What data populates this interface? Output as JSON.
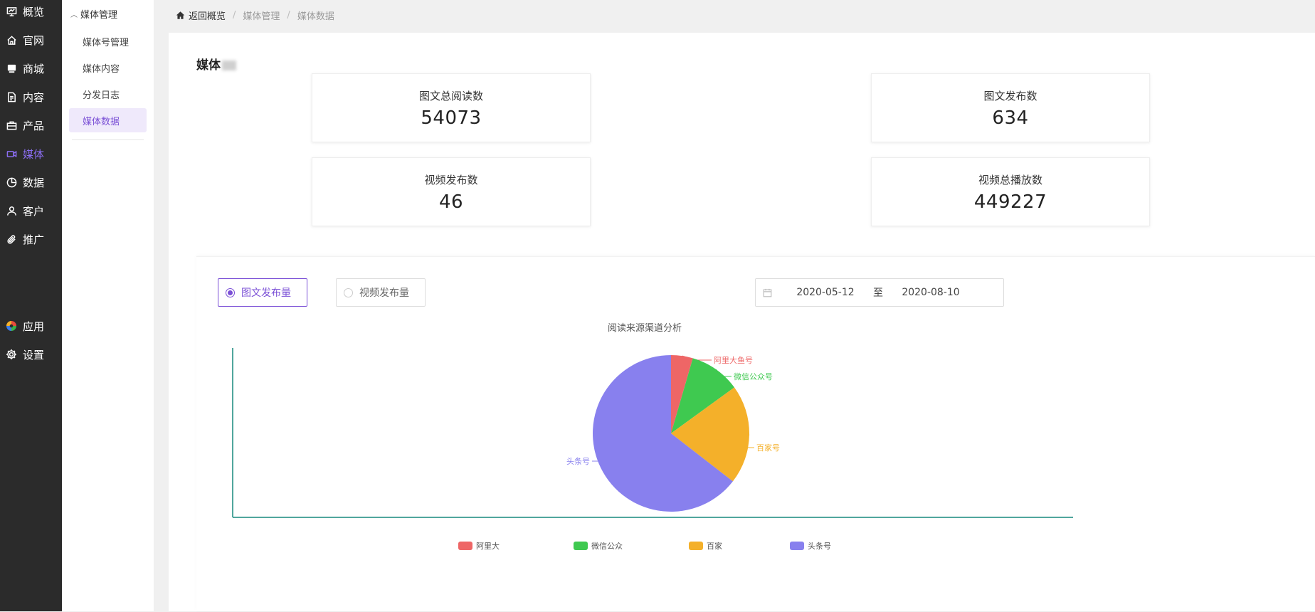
{
  "nav": {
    "items": [
      {
        "label": "概览",
        "icon": "dashboard-icon"
      },
      {
        "label": "官网",
        "icon": "home-icon"
      },
      {
        "label": "商城",
        "icon": "store-icon"
      },
      {
        "label": "内容",
        "icon": "document-icon"
      },
      {
        "label": "产品",
        "icon": "briefcase-icon"
      },
      {
        "label": "媒体",
        "icon": "video-icon"
      },
      {
        "label": "数据",
        "icon": "pie-icon"
      },
      {
        "label": "客户",
        "icon": "user-icon"
      },
      {
        "label": "推广",
        "icon": "paperclip-icon"
      }
    ],
    "bottom": [
      {
        "label": "应用",
        "icon": "apps-icon"
      },
      {
        "label": "设置",
        "icon": "gear-icon"
      }
    ],
    "active": "媒体"
  },
  "subnav": {
    "title": "媒体管理",
    "items": [
      "媒体号管理",
      "媒体内容",
      "分发日志",
      "媒体数据"
    ],
    "active": "媒体数据"
  },
  "breadcrumb": {
    "home": "返回概览",
    "crumbs": [
      "媒体管理",
      "媒体数据"
    ]
  },
  "section_title": "媒体",
  "stats": [
    {
      "label": "图文总阅读数",
      "value": "54073"
    },
    {
      "label": "图文发布数",
      "value": "634"
    },
    {
      "label": "视频发布数",
      "value": "46"
    },
    {
      "label": "视频总播放数",
      "value": "449227"
    }
  ],
  "tabs": [
    {
      "label": "图文发布量",
      "active": true
    },
    {
      "label": "视频发布量",
      "active": false
    }
  ],
  "date_range": {
    "start": "2020-05-12",
    "separator": "至",
    "end": "2020-08-10"
  },
  "colors": {
    "accent": "#7a4fd6",
    "slice_red": "#ee6666",
    "slice_green": "#3fc950",
    "slice_orange": "#f4b02a",
    "slice_purple": "#8880ee",
    "axis": "#17897d"
  },
  "chart_data": {
    "type": "pie",
    "title": "阅读来源渠道分析",
    "series": [
      {
        "name": "阿里大鱼号",
        "value": 4.5,
        "color": "#ee6666"
      },
      {
        "name": "微信公众号",
        "value": 10.5,
        "color": "#3fc950"
      },
      {
        "name": "百家号",
        "value": 20.5,
        "color": "#f4b02a"
      },
      {
        "name": "头条号",
        "value": 64.5,
        "color": "#8880ee"
      }
    ],
    "legend_labels": [
      "阿里大",
      "微信公众",
      "百家",
      "头条号"
    ],
    "legend_position": "bottom"
  }
}
